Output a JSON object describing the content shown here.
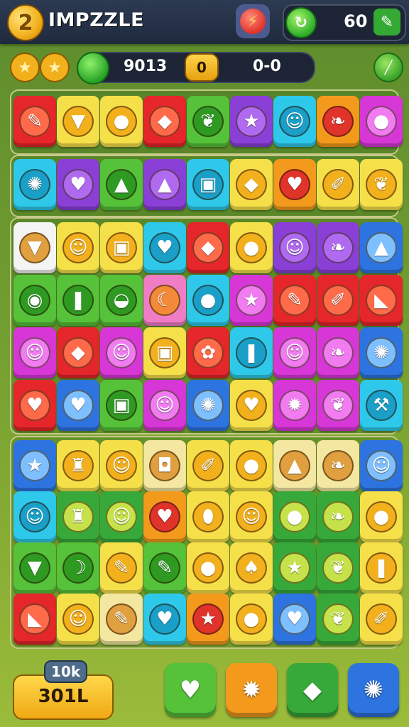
{
  "header": {
    "logo_digit": "2",
    "title": "IMPZZLE",
    "record_icon": "rec-bolt-icon",
    "energy_value": "60"
  },
  "stats": {
    "score": "9013",
    "middle_coin": "0",
    "ratio": "0-0"
  },
  "colors": {
    "red": "#e5262a",
    "yellow": "#f6e04a",
    "lime": "#55c23a",
    "cyan": "#2ec9ea",
    "purple": "#8a3fd6",
    "magenta": "#d637d6",
    "orange": "#f39a1c",
    "blue": "#2e74e0",
    "green": "#37a93a",
    "cream": "#f3e7a2",
    "white": "#f4f4f4",
    "pink": "#f07cc6"
  },
  "boards": [
    {
      "rows": [
        [
          [
            "red",
            "pencil-icon"
          ],
          [
            "yellow",
            "cup-icon"
          ],
          [
            "yellow",
            "melon-icon"
          ],
          [
            "red",
            "lemon-icon"
          ],
          [
            "lime",
            "pepper-icon"
          ],
          [
            "purple",
            "star-icon"
          ],
          [
            "cyan",
            "robot-icon"
          ],
          [
            "orange",
            "feather-icon"
          ],
          [
            "magenta",
            "plum-icon"
          ]
        ]
      ]
    },
    {
      "rows": [
        [
          [
            "cyan",
            "shell-icon"
          ],
          [
            "purple",
            "apple-icon"
          ],
          [
            "lime",
            "cupcake-icon"
          ],
          [
            "purple",
            "cake-icon"
          ],
          [
            "cyan",
            "jar-icon"
          ],
          [
            "yellow",
            "mango-icon"
          ],
          [
            "orange",
            "apple-icon"
          ],
          [
            "yellow",
            "brush-icon"
          ],
          [
            "yellow",
            "chili-icon"
          ]
        ]
      ]
    },
    {
      "rows": [
        [
          [
            "white",
            "basket-icon"
          ],
          [
            "yellow",
            "face-icon"
          ],
          [
            "yellow",
            "jar-icon"
          ],
          [
            "cyan",
            "apple-icon"
          ],
          [
            "red",
            "pear-icon"
          ],
          [
            "yellow",
            "plum-icon"
          ],
          [
            "purple",
            "face-icon"
          ],
          [
            "purple",
            "feather-icon"
          ],
          [
            "blue",
            "cone-icon"
          ]
        ],
        [
          [
            "lime",
            "roll-icon"
          ],
          [
            "lime",
            "candy-icon"
          ],
          [
            "lime",
            "bowl-icon"
          ],
          [
            "pink",
            "shrimp-icon"
          ],
          [
            "cyan",
            "plum-icon"
          ],
          [
            "magenta",
            "star-icon"
          ],
          [
            "red",
            "pencil-icon"
          ],
          [
            "red",
            "brush-icon"
          ],
          [
            "red",
            "cheese-icon"
          ]
        ],
        [
          [
            "magenta",
            "face-icon"
          ],
          [
            "red",
            "lemon-icon"
          ],
          [
            "magenta",
            "face-icon"
          ],
          [
            "yellow",
            "mug-icon"
          ],
          [
            "red",
            "berry-icon"
          ],
          [
            "cyan",
            "candy-icon"
          ],
          [
            "magenta",
            "face-icon"
          ],
          [
            "magenta",
            "feather-icon"
          ],
          [
            "blue",
            "shell-icon"
          ]
        ],
        [
          [
            "red",
            "apple-icon"
          ],
          [
            "blue",
            "apple-icon"
          ],
          [
            "lime",
            "jar-icon"
          ],
          [
            "magenta",
            "face-icon"
          ],
          [
            "blue",
            "shell-icon"
          ],
          [
            "yellow",
            "apple-icon"
          ],
          [
            "magenta",
            "sun-icon"
          ],
          [
            "magenta",
            "pepper-icon"
          ],
          [
            "cyan",
            "hammer-icon"
          ]
        ]
      ]
    },
    {
      "rows": [
        [
          [
            "blue",
            "star-icon"
          ],
          [
            "yellow",
            "statue-icon"
          ],
          [
            "yellow",
            "face-icon"
          ],
          [
            "cream",
            "lamp-icon"
          ],
          [
            "yellow",
            "brush-icon"
          ],
          [
            "yellow",
            "orange-icon"
          ],
          [
            "cream",
            "cupcake-icon"
          ],
          [
            "cream",
            "feather-icon"
          ],
          [
            "blue",
            "face-icon"
          ]
        ],
        [
          [
            "cyan",
            "face-icon"
          ],
          [
            "green",
            "statue-icon"
          ],
          [
            "green",
            "face-icon"
          ],
          [
            "orange",
            "apple-icon"
          ],
          [
            "yellow",
            "egg-icon"
          ],
          [
            "yellow",
            "face-icon"
          ],
          [
            "green",
            "plum-icon"
          ],
          [
            "green",
            "feather-icon"
          ],
          [
            "yellow",
            "plum-icon"
          ]
        ],
        [
          [
            "lime",
            "cup-icon"
          ],
          [
            "lime",
            "banana-icon"
          ],
          [
            "yellow",
            "pencil-icon"
          ],
          [
            "lime",
            "pencil-icon"
          ],
          [
            "yellow",
            "plum-icon"
          ],
          [
            "yellow",
            "hat-icon"
          ],
          [
            "green",
            "star-icon"
          ],
          [
            "green",
            "pepper-icon"
          ],
          [
            "yellow",
            "candy-icon"
          ]
        ],
        [
          [
            "red",
            "cheese-icon"
          ],
          [
            "yellow",
            "face-icon"
          ],
          [
            "cream",
            "pencil-icon"
          ],
          [
            "cyan",
            "apple-icon"
          ],
          [
            "orange",
            "star-icon"
          ],
          [
            "yellow",
            "plum-icon"
          ],
          [
            "blue",
            "apple-icon"
          ],
          [
            "green",
            "chili-icon"
          ],
          [
            "yellow",
            "brush-icon"
          ]
        ]
      ]
    }
  ],
  "bottom": {
    "badge": "10k",
    "counter": "301L",
    "powerups": [
      [
        "lime",
        "heart-icon"
      ],
      [
        "orange",
        "sun-icon"
      ],
      [
        "green",
        "gem-icon"
      ],
      [
        "blue",
        "shell-icon"
      ]
    ]
  }
}
